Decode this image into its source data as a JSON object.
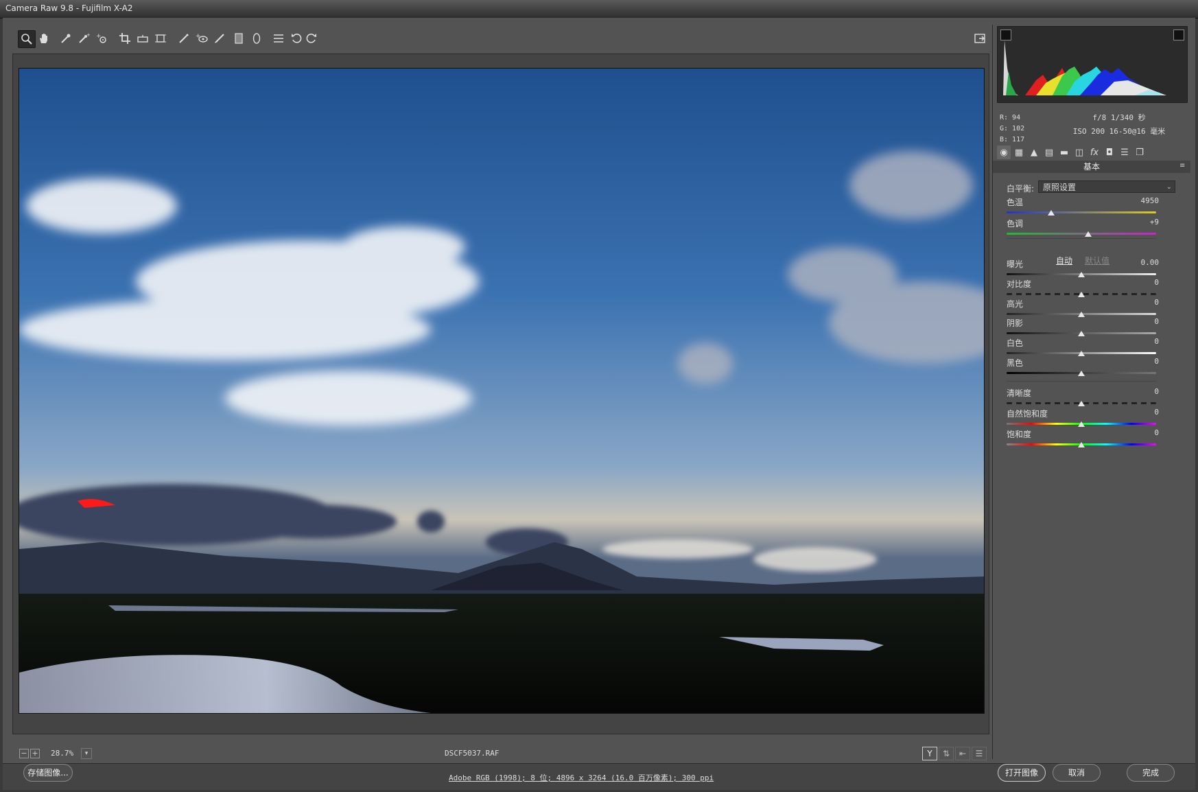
{
  "window": {
    "title": "Camera Raw 9.8 -  Fujifilm X-A2"
  },
  "toolbar": {
    "tools": [
      {
        "name": "zoom-tool",
        "icon": "magnifier-icon",
        "active": true
      },
      {
        "name": "hand-tool",
        "icon": "hand-icon"
      },
      {
        "name": "white-balance-tool",
        "icon": "eyedropper-icon"
      },
      {
        "name": "color-sampler-tool",
        "icon": "color-sampler-icon"
      },
      {
        "name": "targeted-adjustment-tool",
        "icon": "target-adjust-icon"
      },
      {
        "name": "crop-tool",
        "icon": "crop-icon"
      },
      {
        "name": "straighten-tool",
        "icon": "level-icon"
      },
      {
        "name": "transform-tool",
        "icon": "transform-icon"
      },
      {
        "name": "spot-removal-tool",
        "icon": "spot-removal-icon"
      },
      {
        "name": "red-eye-tool",
        "icon": "red-eye-icon"
      },
      {
        "name": "adjustment-brush-tool",
        "icon": "brush-icon"
      },
      {
        "name": "graduated-filter-tool",
        "icon": "gradient-icon"
      },
      {
        "name": "radial-filter-tool",
        "icon": "ellipse-icon"
      },
      {
        "name": "preferences-button",
        "icon": "list-icon"
      },
      {
        "name": "rotate-left-button",
        "icon": "rotate-ccw-icon"
      },
      {
        "name": "rotate-right-button",
        "icon": "rotate-cw-icon"
      }
    ],
    "fullscreen_icon": "fullscreen-icon"
  },
  "status": {
    "zoom": "28.7%",
    "filename": "DSCF5037.RAF",
    "view_y": "Y"
  },
  "bottom": {
    "save_label": "存储图像...",
    "workflow": "Adobe RGB (1998); 8 位; 4896 x 3264 (16.0 百万像素); 300 ppi",
    "open_label": "打开图像",
    "cancel_label": "取消",
    "done_label": "完成"
  },
  "info": {
    "r": "R:   94",
    "g": "G:  102",
    "b": "B:  117",
    "exif_line1": "f/8  1/340 秒",
    "exif_line2": "ISO 200  16-50@16 毫米"
  },
  "panel": {
    "title": "基本",
    "wb_label": "白平衡:",
    "wb_value": "原照设置",
    "auto": "自动",
    "default": "默认值",
    "sliders": [
      {
        "key": "temp",
        "label": "色温",
        "value": "4950",
        "pos": 0.3
      },
      {
        "key": "tint",
        "label": "色调",
        "value": "+9",
        "pos": 0.545
      },
      {
        "key": "exposure",
        "label": "曝光",
        "value": "0.00",
        "pos": 0.5
      },
      {
        "key": "contrast",
        "label": "对比度",
        "value": "0",
        "pos": 0.5
      },
      {
        "key": "highlights",
        "label": "高光",
        "value": "0",
        "pos": 0.5
      },
      {
        "key": "shadows",
        "label": "阴影",
        "value": "0",
        "pos": 0.5
      },
      {
        "key": "whites",
        "label": "白色",
        "value": "0",
        "pos": 0.5
      },
      {
        "key": "blacks",
        "label": "黑色",
        "value": "0",
        "pos": 0.5
      },
      {
        "key": "clarity",
        "label": "清晰度",
        "value": "0",
        "pos": 0.5
      },
      {
        "key": "vibrance",
        "label": "自然饱和度",
        "value": "0",
        "pos": 0.5
      },
      {
        "key": "saturation",
        "label": "饱和度",
        "value": "0",
        "pos": 0.5
      }
    ]
  }
}
